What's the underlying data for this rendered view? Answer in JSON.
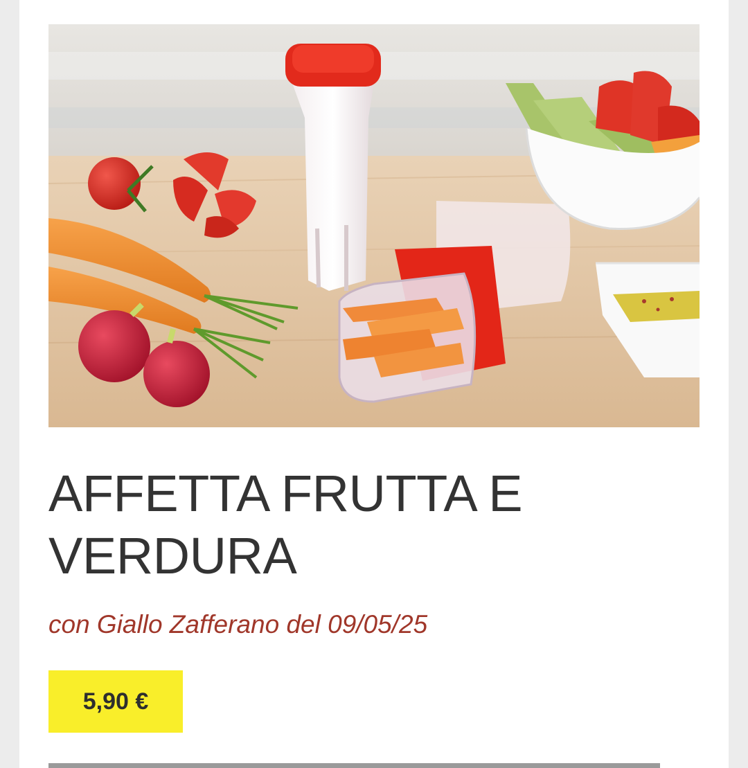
{
  "product": {
    "image_alt": "Affetta frutta e verdura",
    "title": "AFFETTA FRUTTA E VERDURA",
    "subtitle": "con Giallo Zafferano del 09/05/25",
    "price": "5,90 €"
  },
  "colors": {
    "page_background": "#ececec",
    "card_background": "#ffffff",
    "title": "#333333",
    "subtitle": "#a0372a",
    "price_badge": "#f9ee2a",
    "divider": "#9a9a9a"
  }
}
